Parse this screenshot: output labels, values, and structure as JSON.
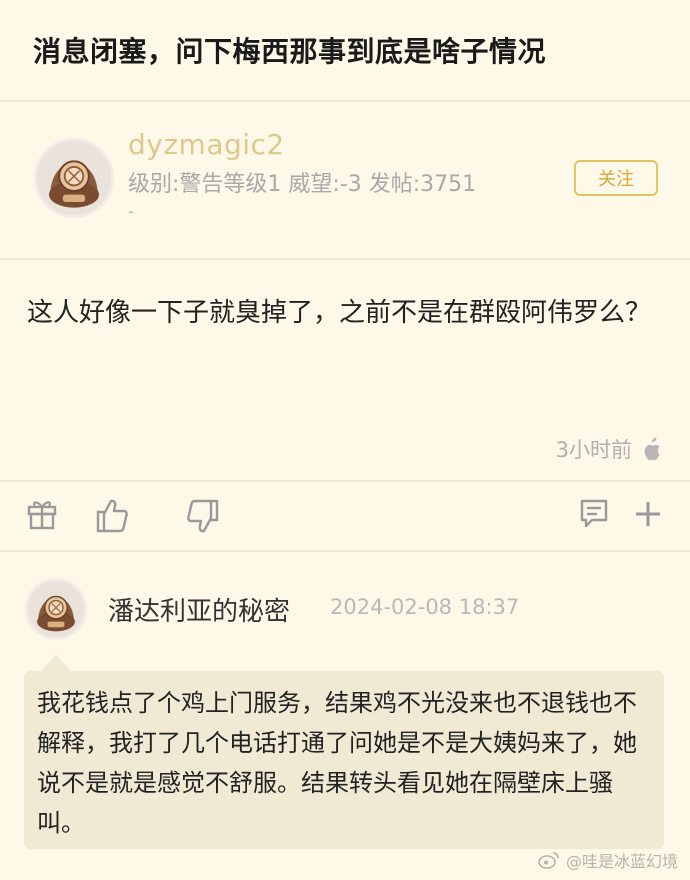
{
  "header": {
    "title": "消息闭塞，问下梅西那事到底是啥子情况"
  },
  "post": {
    "username": "dyzmagic2",
    "meta": "级别:警告等级1 威望:-3 发帖:3751",
    "meta_extra": "-",
    "follow_label": "关注",
    "body": "这人好像一下子就臭掉了，之前不是在群殴阿伟罗么？",
    "time": "3小时前"
  },
  "actions": {
    "icons": [
      "gift-icon",
      "like-icon",
      "dislike-icon",
      "comment-icon",
      "plus-icon"
    ]
  },
  "reply": {
    "username": "潘达利亚的秘密",
    "time": "2024-02-08 18:37",
    "quote": "我花钱点了个鸡上门服务，结果鸡不光没来也不退钱也不解释，我打了几个电话打通了问她是不是大姨妈来了，她说不是就是感觉不舒服。结果转头看见她在隔壁床上骚叫。"
  },
  "watermark": {
    "text": "@哇是冰蓝幻境"
  },
  "colors": {
    "background": "#fdf8e8",
    "username": "#dfc88a",
    "follow_border": "#e4c462",
    "quote_bg": "#f0ead4"
  }
}
